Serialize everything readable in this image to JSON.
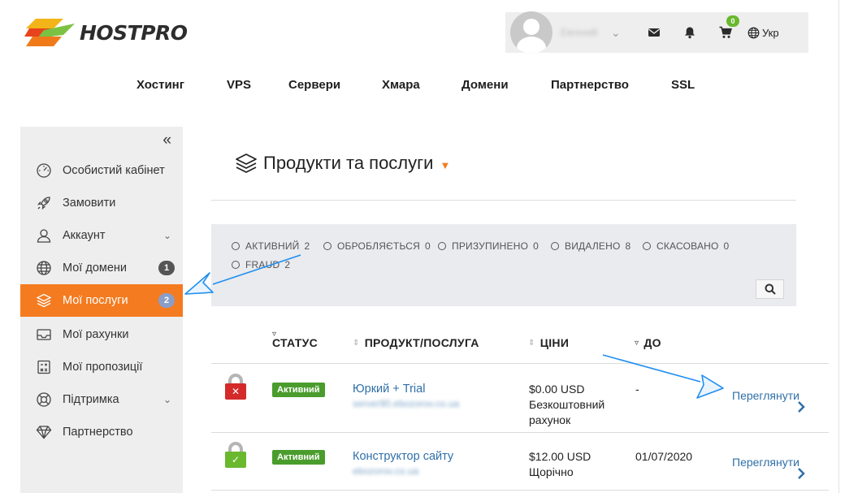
{
  "logo": {
    "text": "HOSTPRO"
  },
  "userbar": {
    "username": "Евгений",
    "cart_count": "0",
    "language": "Укр"
  },
  "mainnav": [
    "Хостинг",
    "VPS",
    "Сервери",
    "Хмара",
    "Домени",
    "Партнерство",
    "SSL"
  ],
  "sidebar": {
    "collapse_glyph": "«",
    "items": [
      {
        "label": "Особистий кабінет",
        "icon": "dashboard-icon"
      },
      {
        "label": "Замовити",
        "icon": "rocket-icon"
      },
      {
        "label": "Аккаунт",
        "icon": "user-icon",
        "expandable": true
      },
      {
        "label": "Мої домени",
        "icon": "globe-icon",
        "badge": "1"
      },
      {
        "label": "Мої послуги",
        "icon": "layers-icon",
        "badge": "2",
        "active": true
      },
      {
        "label": "Мої рахунки",
        "icon": "inbox-icon"
      },
      {
        "label": "Мої пропозиції",
        "icon": "calculator-icon"
      },
      {
        "label": "Підтримка",
        "icon": "lifebuoy-icon",
        "expandable": true
      },
      {
        "label": "Партнерство",
        "icon": "diamond-icon"
      }
    ]
  },
  "page": {
    "title": "Продукти та послуги"
  },
  "filters": [
    {
      "label": "АКТИВНИЙ",
      "count": "2"
    },
    {
      "label": "ОБРОБЛЯЄТЬСЯ",
      "count": "0"
    },
    {
      "label": "ПРИЗУПИНЕНО",
      "count": "0"
    },
    {
      "label": "ВИДАЛЕНО",
      "count": "8"
    },
    {
      "label": "СКАСОВАНО",
      "count": "0"
    },
    {
      "label": "FRAUD",
      "count": "2"
    }
  ],
  "table": {
    "headers": {
      "status": "СТАТУС",
      "product": "ПРОДУКТ/ПОСЛУГА",
      "price": "ЦІНИ",
      "due": "ДО"
    },
    "rows": [
      {
        "ssl": "unsecured",
        "status": "Активний",
        "product": "Юркий + Trial",
        "domain": "server90.ebozorov.co.ua",
        "price": "$0.00 USD",
        "cycle_1": "Безкоштовний",
        "cycle_2": "рахунок",
        "due": "-",
        "action": "Переглянути"
      },
      {
        "ssl": "secured",
        "status": "Активний",
        "product": "Конструктор сайту",
        "domain": "ebozorov.co.ua",
        "price": "$12.00 USD",
        "cycle_1": "Щорічно",
        "cycle_2": "",
        "due": "01/07/2020",
        "action": "Переглянути"
      }
    ]
  },
  "colors": {
    "accent": "#f47b20",
    "link": "#2f6fa8",
    "status_active": "#4a9c2d",
    "annotation": "#1f8ef1"
  }
}
